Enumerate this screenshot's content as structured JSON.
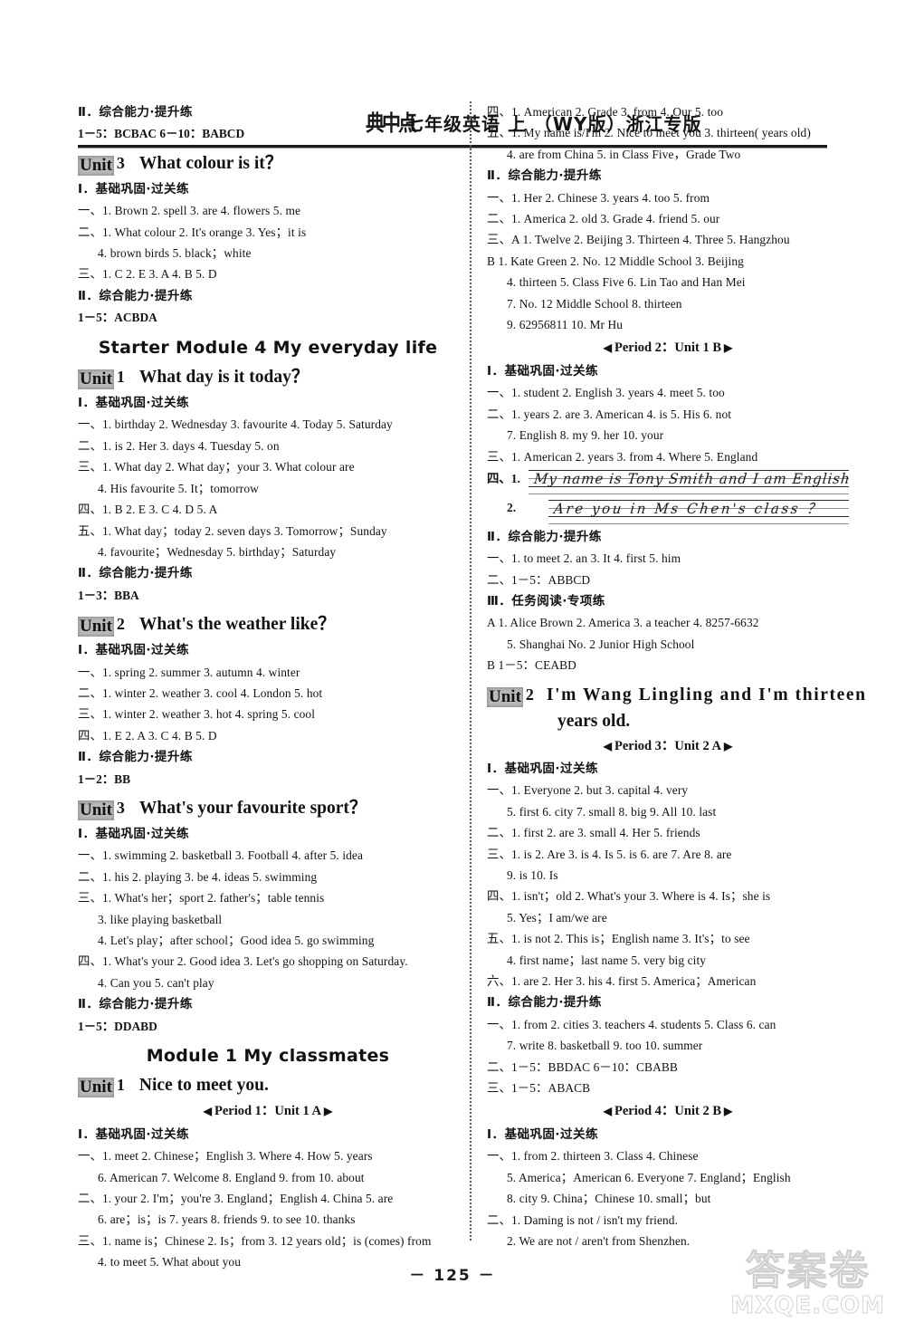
{
  "header": {
    "logo": "典中点",
    "title": "七年级英语 上 （WY版）浙江专版"
  },
  "labels": {
    "section_basic": "Ⅰ．基础巩固·过关练",
    "section_comprehensive": "Ⅱ．综合能力·提升练",
    "section_reading": "Ⅲ．任务阅读·专项练"
  },
  "left_column": [
    {
      "kind": "cn-head",
      "text": "Ⅱ．综合能力·提升练"
    },
    {
      "kind": "ans",
      "text": "1－5：BCBAC  6－10：BABCD"
    },
    {
      "kind": "unit",
      "box": "Unit",
      "no": "3",
      "title": "What colour is it？"
    },
    {
      "kind": "cn-head",
      "text": "Ⅰ．基础巩固·过关练"
    },
    {
      "kind": "line",
      "text": "一、1. Brown  2. spell  3. are  4. flowers  5. me"
    },
    {
      "kind": "line",
      "text": "二、1. What colour  2. It's orange  3. Yes；it is"
    },
    {
      "kind": "line",
      "indent": true,
      "text": "4. brown birds  5. black；white"
    },
    {
      "kind": "line",
      "text": "三、1. C  2. E  3. A  4. B  5. D"
    },
    {
      "kind": "cn-head",
      "text": "Ⅱ．综合能力·提升练"
    },
    {
      "kind": "ans",
      "text": "1－5：ACBDA"
    },
    {
      "kind": "module",
      "text": "Starter Module 4   My everyday life"
    },
    {
      "kind": "unit",
      "box": "Unit",
      "no": "1",
      "title": "What day is it today？"
    },
    {
      "kind": "cn-head",
      "text": "Ⅰ．基础巩固·过关练"
    },
    {
      "kind": "line",
      "text": "一、1. birthday  2. Wednesday  3. favourite  4. Today  5. Saturday"
    },
    {
      "kind": "line",
      "text": "二、1. is  2. Her  3. days  4. Tuesday  5. on"
    },
    {
      "kind": "line",
      "text": "三、1. What day  2. What day；your  3. What colour are"
    },
    {
      "kind": "line",
      "indent": true,
      "text": "4. His favourite  5. It；tomorrow"
    },
    {
      "kind": "line",
      "text": "四、1. B  2. E  3. C  4. D  5. A"
    },
    {
      "kind": "line",
      "text": "五、1. What day；today  2. seven days  3. Tomorrow；Sunday"
    },
    {
      "kind": "line",
      "indent": true,
      "text": "4. favourite；Wednesday  5. birthday；Saturday"
    },
    {
      "kind": "cn-head",
      "text": "Ⅱ．综合能力·提升练"
    },
    {
      "kind": "ans",
      "text": "1－3：BBA"
    },
    {
      "kind": "unit",
      "box": "Unit",
      "no": "2",
      "title": "What's the weather like？"
    },
    {
      "kind": "cn-head",
      "text": "Ⅰ．基础巩固·过关练"
    },
    {
      "kind": "line",
      "text": "一、1. spring  2. summer  3. autumn  4. winter"
    },
    {
      "kind": "line",
      "text": "二、1. winter  2. weather  3. cool  4. London  5. hot"
    },
    {
      "kind": "line",
      "text": "三、1. winter  2. weather  3. hot  4. spring  5. cool"
    },
    {
      "kind": "line",
      "text": "四、1. E  2. A  3. C  4. B  5. D"
    },
    {
      "kind": "cn-head",
      "text": "Ⅱ．综合能力·提升练"
    },
    {
      "kind": "ans",
      "text": "1－2：BB"
    },
    {
      "kind": "unit",
      "box": "Unit",
      "no": "3",
      "title": "What's your favourite sport？"
    },
    {
      "kind": "cn-head",
      "text": "Ⅰ．基础巩固·过关练"
    },
    {
      "kind": "line",
      "text": "一、1. swimming  2. basketball  3. Football  4. after  5. idea"
    },
    {
      "kind": "line",
      "text": "二、1. his  2. playing  3. be  4. ideas  5. swimming"
    },
    {
      "kind": "line",
      "text": "三、1. What's her；sport  2. father's；table tennis"
    },
    {
      "kind": "line",
      "indent": true,
      "text": "3. like playing basketball"
    },
    {
      "kind": "line",
      "indent": true,
      "text": "4. Let's play；after school；Good idea  5. go swimming"
    },
    {
      "kind": "line",
      "text": "四、1. What's your  2. Good idea  3. Let's go shopping on Saturday."
    },
    {
      "kind": "line",
      "indent": true,
      "text": "4. Can you  5. can't play"
    },
    {
      "kind": "cn-head",
      "text": "Ⅱ．综合能力·提升练"
    },
    {
      "kind": "ans",
      "text": "1－5：DDABD"
    },
    {
      "kind": "module",
      "text": "Module 1   My classmates"
    },
    {
      "kind": "unit",
      "box": "Unit",
      "no": "1",
      "title": "Nice to meet you."
    },
    {
      "kind": "period",
      "text": "Period 1：Unit 1 A"
    },
    {
      "kind": "cn-head",
      "text": "Ⅰ．基础巩固·过关练"
    },
    {
      "kind": "line",
      "text": "一、1. meet  2. Chinese；English  3. Where  4. How  5. years"
    },
    {
      "kind": "line",
      "indent": true,
      "text": "6. American  7. Welcome  8. England  9. from  10. about"
    },
    {
      "kind": "line",
      "text": "二、1. your  2. I'm；you're  3. England；English  4. China  5. are"
    },
    {
      "kind": "line",
      "indent": true,
      "text": "6. are；is；is  7. years  8. friends  9. to see  10. thanks"
    },
    {
      "kind": "line",
      "text": "三、1. name is；Chinese  2. Is；from  3. 12 years old；is (comes) from"
    },
    {
      "kind": "line",
      "indent": true,
      "text": "4. to meet  5. What about you"
    }
  ],
  "right_column": [
    {
      "kind": "line",
      "text": "四、1. American  2. Grade  3. from  4. Our  5. too"
    },
    {
      "kind": "line",
      "text": "五、1. My name is/I'm  2. Nice to meet you  3. thirteen( years old)"
    },
    {
      "kind": "line",
      "indent": true,
      "text": "4. are from China  5. in Class Five，Grade Two"
    },
    {
      "kind": "cn-head",
      "text": "Ⅱ．综合能力·提升练"
    },
    {
      "kind": "line",
      "text": "一、1. Her  2. Chinese  3. years  4. too  5. from"
    },
    {
      "kind": "line",
      "text": "二、1. America  2. old  3. Grade  4. friend  5. our"
    },
    {
      "kind": "line",
      "text": "三、A  1. Twelve  2. Beijing  3. Thirteen  4. Three  5. Hangzhou"
    },
    {
      "kind": "line",
      "text": "B  1. Kate Green  2. No. 12 Middle School  3. Beijing"
    },
    {
      "kind": "line",
      "indent": true,
      "text": "4. thirteen  5. Class Five  6. Lin Tao and Han Mei"
    },
    {
      "kind": "line",
      "indent": true,
      "text": "7. No. 12 Middle School  8. thirteen"
    },
    {
      "kind": "line",
      "indent": true,
      "text": "9. 62956811  10. Mr Hu"
    },
    {
      "kind": "period",
      "text": "Period 2：Unit 1 B"
    },
    {
      "kind": "cn-head",
      "text": "Ⅰ．基础巩固·过关练"
    },
    {
      "kind": "line",
      "text": "一、1. student  2. English  3. years  4. meet  5. too"
    },
    {
      "kind": "line",
      "text": "二、1. years  2. are  3. American  4. is  5. His  6. not"
    },
    {
      "kind": "line",
      "indent": true,
      "text": "7. English  8. my  9. her  10. your"
    },
    {
      "kind": "line",
      "text": "三、1. American  2. years  3. from  4. Where  5. England"
    },
    {
      "kind": "hand",
      "label": "四、1.",
      "text": "My name is Tony Smith and I am English"
    },
    {
      "kind": "hand",
      "label": "2.",
      "indent": true,
      "text": "Are you in Ms Chen's class ？"
    },
    {
      "kind": "cn-head",
      "text": "Ⅱ．综合能力·提升练"
    },
    {
      "kind": "line",
      "text": "一、1. to meet  2. an  3. It  4. first  5. him"
    },
    {
      "kind": "line",
      "text": "二、1－5：ABBCD"
    },
    {
      "kind": "cn-head",
      "text": "Ⅲ．任务阅读·专项练"
    },
    {
      "kind": "line",
      "text": "A  1. Alice Brown  2. America  3. a teacher  4. 8257-6632"
    },
    {
      "kind": "line",
      "indent": true,
      "text": "5. Shanghai No. 2 Junior High School"
    },
    {
      "kind": "line",
      "text": "B  1－5：CEABD"
    },
    {
      "kind": "unit2",
      "box": "Unit",
      "no": "2",
      "title": "I'm Wang Lingling and I'm thirteen",
      "title2": "years old."
    },
    {
      "kind": "period",
      "text": "Period 3：Unit 2 A"
    },
    {
      "kind": "cn-head",
      "text": "Ⅰ．基础巩固·过关练"
    },
    {
      "kind": "line",
      "text": "一、1. Everyone  2. but  3. capital  4. very"
    },
    {
      "kind": "line",
      "indent": true,
      "text": "5. first  6. city  7. small  8. big  9. All  10. last"
    },
    {
      "kind": "line",
      "text": "二、1. first  2. are  3. small  4. Her  5. friends"
    },
    {
      "kind": "line",
      "text": "三、1. is  2. Are  3. is  4. Is  5. is  6. are  7. Are  8. are"
    },
    {
      "kind": "line",
      "indent": true,
      "text": "9. is  10. Is"
    },
    {
      "kind": "line",
      "text": "四、1. isn't；old  2. What's your  3. Where is  4. Is；she is"
    },
    {
      "kind": "line",
      "indent": true,
      "text": "5. Yes；I am/we are"
    },
    {
      "kind": "line",
      "text": "五、1. is not  2. This is；English name  3. It's；to see"
    },
    {
      "kind": "line",
      "indent": true,
      "text": "4. first name；last name  5. very big city"
    },
    {
      "kind": "line",
      "text": "六、1. are  2. Her  3. his  4. first  5. America；American"
    },
    {
      "kind": "cn-head",
      "text": "Ⅱ．综合能力·提升练"
    },
    {
      "kind": "line",
      "text": "一、1. from  2. cities  3. teachers  4. students  5. Class  6. can"
    },
    {
      "kind": "line",
      "indent": true,
      "text": "7. write  8. basketball  9. too  10. summer"
    },
    {
      "kind": "line",
      "text": "二、1－5：BBDAC  6－10：CBABB"
    },
    {
      "kind": "line",
      "text": "三、1－5：ABACB"
    },
    {
      "kind": "period",
      "text": "Period 4：Unit 2 B"
    },
    {
      "kind": "cn-head",
      "text": "Ⅰ．基础巩固·过关练"
    },
    {
      "kind": "line",
      "text": "一、1. from  2. thirteen  3. Class  4. Chinese"
    },
    {
      "kind": "line",
      "indent": true,
      "text": "5. America；American  6. Everyone  7. England；English"
    },
    {
      "kind": "line",
      "indent": true,
      "text": "8. city  9. China；Chinese  10. small；but"
    },
    {
      "kind": "line",
      "text": "二、1. Daming is not / isn't my friend."
    },
    {
      "kind": "line",
      "indent": true,
      "text": "2. We are not / aren't from Shenzhen."
    }
  ],
  "footer": {
    "page_number": "－ 125 －",
    "watermark_cn": "答案卷",
    "watermark_en": "MXQE.COM"
  }
}
